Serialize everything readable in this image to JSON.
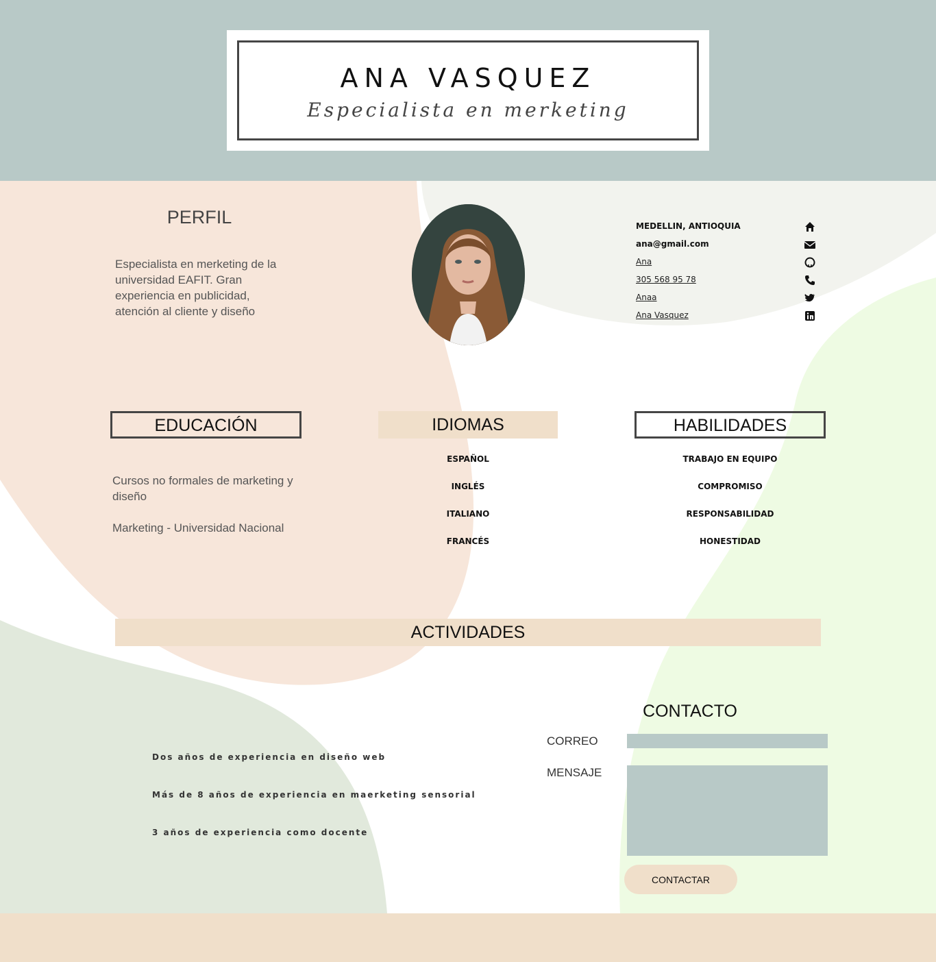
{
  "header": {
    "name": "ANA VASQUEZ",
    "subtitle": "Especialista en merketing"
  },
  "perfil": {
    "title": "PERFIL",
    "text": "Especialista en merketing de la universidad EAFIT. Gran experiencia en publicidad, atención al cliente y diseño"
  },
  "contact_info": {
    "location": "MEDELLIN, ANTIOQUIA",
    "email": "ana@gmail.com",
    "github": "Ana",
    "phone": "305 568 95 78",
    "twitter": "Anaa",
    "linkedin": "Ana Vasquez",
    "icons": [
      "home-icon",
      "envelope-icon",
      "github-icon",
      "phone-icon",
      "twitter-icon",
      "linkedin-icon"
    ]
  },
  "education": {
    "title": "EDUCACIÓN",
    "items": [
      "Cursos no formales de marketing y diseño",
      "Marketing - Universidad Nacional"
    ]
  },
  "languages": {
    "title": "IDIOMAS",
    "items": [
      "ESPAÑOL",
      "INGLÉS",
      "ITALIANO",
      "FRANCÉS"
    ]
  },
  "skills": {
    "title": "HABILIDADES",
    "items": [
      "TRABAJO EN EQUIPO",
      "COMPROMISO",
      "RESPONSABILIDAD",
      "HONESTIDAD"
    ]
  },
  "activities": {
    "title": "ACTIVIDADES",
    "items": [
      "Dos años de experiencia en diseño web",
      "Más de 8 años de experiencia en maerketing sensorial",
      "3 años de experiencia como docente"
    ]
  },
  "contact_form": {
    "title": "CONTACTO",
    "email_label": "CORREO",
    "email_value": "",
    "message_label": "MENSAJE",
    "message_value": "",
    "submit_label": "CONTACTAR"
  },
  "colors": {
    "header_bg": "#b8c9c7",
    "peach": "#f0dfca",
    "peach_blob": "#f7e6da",
    "grey_blob": "#f2f3ee",
    "green_blob": "#eefbe3",
    "sage_blob": "#e1e9dc",
    "input_bg": "#b8c9c7"
  }
}
